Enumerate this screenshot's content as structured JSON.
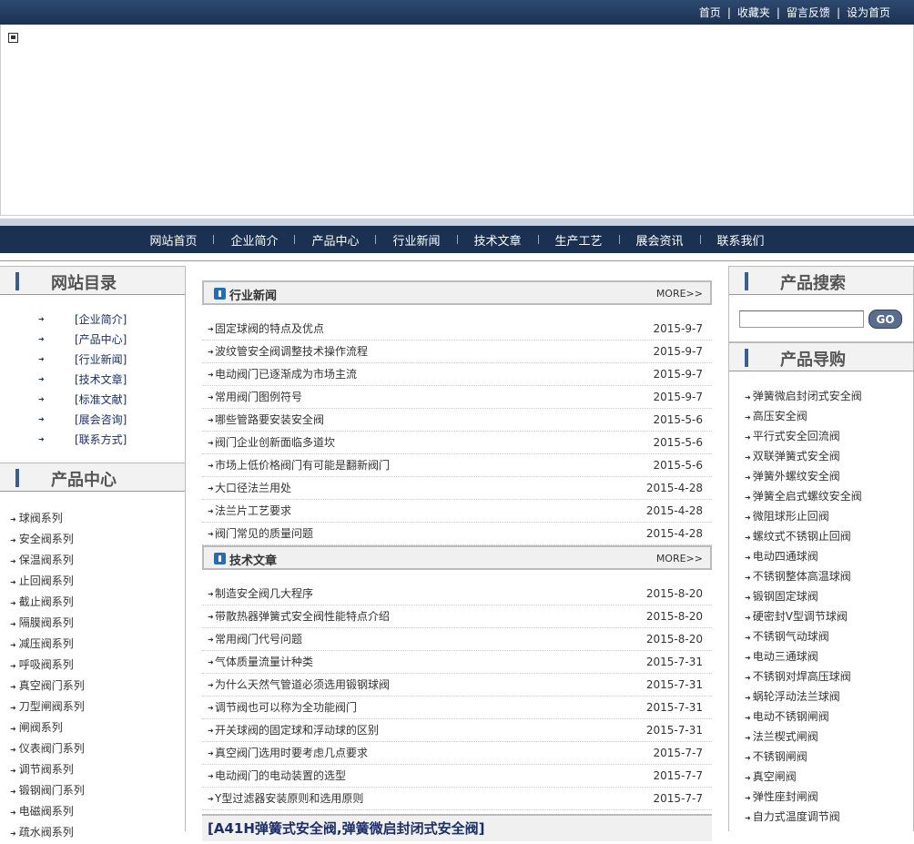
{
  "topbar": {
    "links": [
      "首页",
      "收藏夹",
      "留言反馈",
      "设为首页"
    ]
  },
  "nav": {
    "items": [
      "网站首页",
      "企业简介",
      "产品中心",
      "行业新闻",
      "技术文章",
      "生产工艺",
      "展会资讯",
      "联系我们"
    ]
  },
  "left": {
    "directory_title": "网站目录",
    "directory": [
      "[企业简介]",
      "[产品中心]",
      "[行业新闻]",
      "[技术文章]",
      "[标准文献]",
      "[展会咨询]",
      "[联系方式]"
    ],
    "products_title": "产品中心",
    "products": [
      "球阀系列",
      "安全阀系列",
      "保温阀系列",
      "止回阀系列",
      "截止阀系列",
      "隔膜阀系列",
      "减压阀系列",
      "呼吸阀系列",
      "真空阀门系列",
      "刀型闸阀系列",
      "闸阀系列",
      "仪表阀门系列",
      "调节阀系列",
      "锻钢阀门系列",
      "电磁阀系列",
      "疏水阀系列"
    ]
  },
  "industry_news": {
    "title": "行业新闻",
    "more": "MORE>>",
    "items": [
      {
        "text": "固定球阀的特点及优点",
        "date": "2015-9-7"
      },
      {
        "text": "波纹管安全阀调整技术操作流程",
        "date": "2015-9-7"
      },
      {
        "text": "电动阀门已逐渐成为市场主流",
        "date": "2015-9-7"
      },
      {
        "text": "常用阀门图例符号",
        "date": "2015-9-7"
      },
      {
        "text": "哪些管路要安装安全阀",
        "date": "2015-5-6"
      },
      {
        "text": "阀门企业创新面临多道坎",
        "date": "2015-5-6"
      },
      {
        "text": "市场上低价格阀门有可能是翻新阀门",
        "date": "2015-5-6"
      },
      {
        "text": "大口径法兰用处",
        "date": "2015-4-28"
      },
      {
        "text": "法兰片工艺要求",
        "date": "2015-4-28"
      },
      {
        "text": "阀门常见的质量问题",
        "date": "2015-4-28"
      }
    ]
  },
  "tech_articles": {
    "title": "技术文章",
    "more": "MORE>>",
    "items": [
      {
        "text": "制造安全阀几大程序",
        "date": "2015-8-20"
      },
      {
        "text": "带散热器弹簧式安全阀性能特点介绍",
        "date": "2015-8-20"
      },
      {
        "text": "常用阀门代号问题",
        "date": "2015-8-20"
      },
      {
        "text": "气体质量流量计种类",
        "date": "2015-7-31"
      },
      {
        "text": "为什么天然气管道必须选用锻钢球阀",
        "date": "2015-7-31"
      },
      {
        "text": "调节阀也可以称为全功能阀门",
        "date": "2015-7-31"
      },
      {
        "text": "开关球阀的固定球和浮动球的区别",
        "date": "2015-7-31"
      },
      {
        "text": "真空阀门选用时要考虑几点要求",
        "date": "2015-7-7"
      },
      {
        "text": "电动阀门的电动装置的选型",
        "date": "2015-7-7"
      },
      {
        "text": "Y型过滤器安装原则和选用原则",
        "date": "2015-7-7"
      }
    ]
  },
  "feature": {
    "title": "[A41H弹簧式安全阀,弹簧微启封闭式安全阀]"
  },
  "right": {
    "search_title": "产品搜索",
    "go": "GO",
    "guide_title": "产品导购",
    "guide": [
      "弹簧微启封闭式安全阀",
      "高压安全阀",
      "平行式安全回流阀",
      "双联弹簧式安全阀",
      "弹簧外螺纹安全阀",
      "弹簧全启式螺纹安全阀",
      "微阻球形止回阀",
      "螺纹式不锈钢止回阀",
      "电动四通球阀",
      "不锈钢整体高温球阀",
      "锻钢固定球阀",
      "硬密封V型调节球阀",
      "不锈钢气动球阀",
      "电动三通球阀",
      "不锈钢对焊高压球阀",
      "蜗轮浮动法兰球阀",
      "电动不锈钢闸阀",
      "法兰楔式闸阀",
      "不锈钢闸阀",
      "真空闸阀",
      "弹性座封闸阀",
      "自力式温度调节阀"
    ]
  }
}
